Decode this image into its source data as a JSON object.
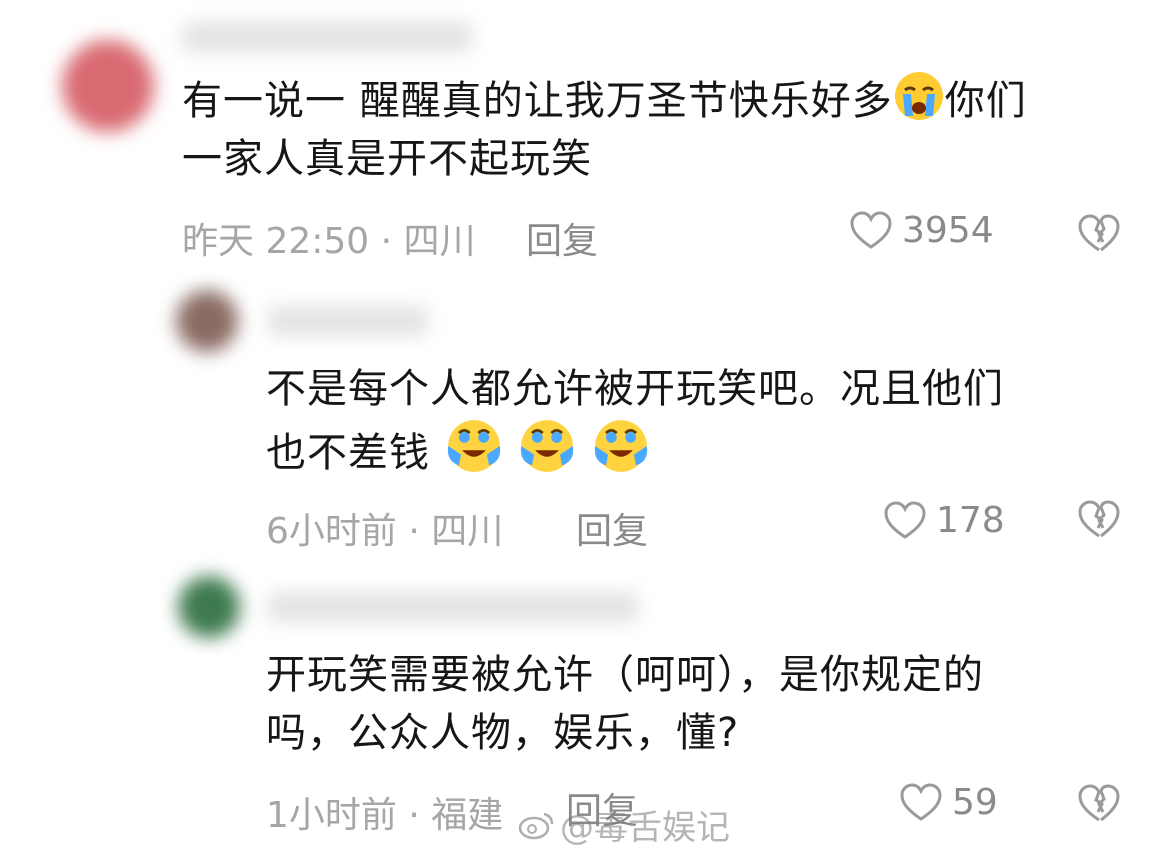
{
  "comments": [
    {
      "text_line1": "有一说一 醒醒真的让我万圣节快乐好多",
      "text_line1_end": "你们",
      "text_line2": "一家人真是开不起玩笑",
      "meta": "昨天 22:50 · 四川",
      "reply_label": "回复",
      "likes": "3954",
      "emoji": "crying-face"
    },
    {
      "text_line1": "不是每个人都允许被开玩笑吧。况且他们",
      "text_line2": "也不差钱",
      "meta": "6小时前 · 四川",
      "reply_label": "回复",
      "likes": "178",
      "emoji": "laugh-cry-face"
    },
    {
      "text_line1": "开玩笑需要被允许（呵呵），是你规定的",
      "text_line2": "吗，公众人物，娱乐，懂?",
      "meta": "1小时前 · 福建",
      "reply_label": "回复",
      "likes": "59"
    }
  ],
  "watermark": "@毒舌娱记",
  "colors": {
    "text": "#161616",
    "meta": "#a6a6a6",
    "icon": "#8a8a8a"
  }
}
